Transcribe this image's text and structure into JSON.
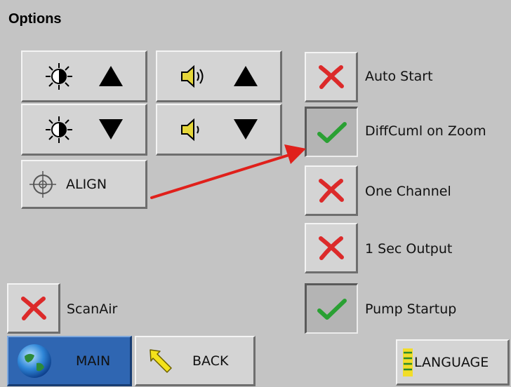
{
  "page": {
    "title": "Options"
  },
  "controls": {
    "brightness_up_icon": "brightness-icon",
    "brightness_down_icon": "brightness-icon",
    "volume_up_icon": "speaker-loud-icon",
    "volume_down_icon": "speaker-icon",
    "align_label": "ALIGN"
  },
  "options": [
    {
      "label": "Auto Start",
      "state": "off"
    },
    {
      "label": "DiffCuml on Zoom",
      "state": "on"
    },
    {
      "label": "One Channel",
      "state": "off"
    },
    {
      "label": "1 Sec Output",
      "state": "off"
    },
    {
      "label": "Pump Startup",
      "state": "on"
    }
  ],
  "scanair": {
    "label": "ScanAir",
    "state": "off"
  },
  "nav": {
    "main_label": "MAIN",
    "back_label": "BACK",
    "language_label": "LANGUAGE"
  },
  "colors": {
    "background": "#c4c4c4",
    "button_face": "#d4d4d4",
    "main_button": "#2f66b2",
    "off_mark": "#dc2a2a",
    "on_mark": "#2aa033",
    "annotation_arrow": "#e0201b"
  }
}
